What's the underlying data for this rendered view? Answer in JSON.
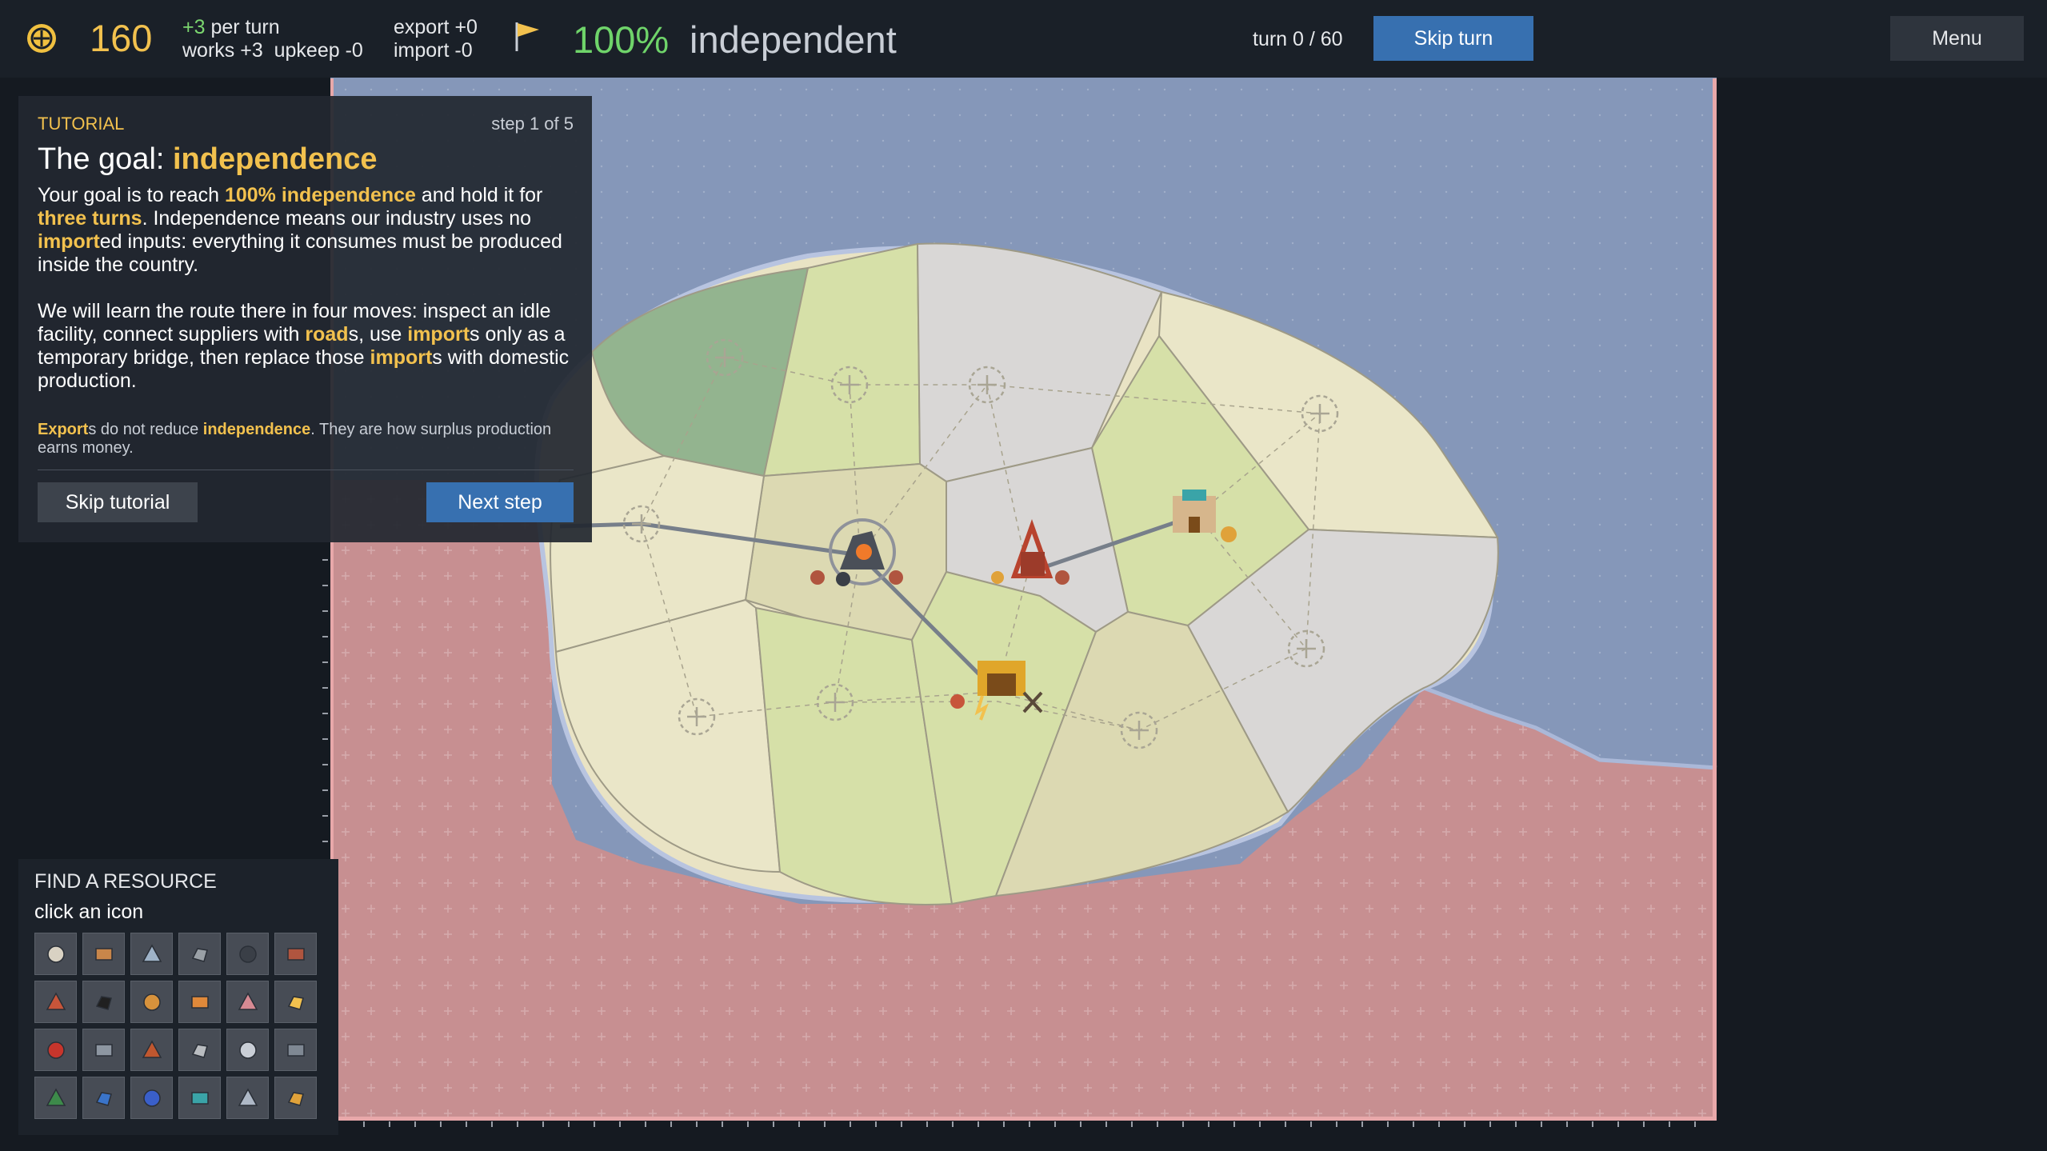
{
  "topbar": {
    "money": "160",
    "per_turn_value": "+3",
    "per_turn_label": "per turn",
    "works_line": "works +3  upkeep -0",
    "export_label": "export",
    "export_value": "+0",
    "import_line": "import -0",
    "independence_pct": "100%",
    "independence_label": "independent",
    "turn": "turn 0 / 60",
    "skip_turn": "Skip turn",
    "menu": "Menu"
  },
  "tutorial": {
    "label": "TUTORIAL",
    "step": "step 1 of 5",
    "title_prefix": "The goal: ",
    "title_highlight": "independence",
    "p1": [
      {
        "t": "Your goal is to reach ",
        "hl": false
      },
      {
        "t": "100% independence",
        "hl": true
      },
      {
        "t": " and hold it for ",
        "hl": false
      },
      {
        "t": "three turns",
        "hl": true
      },
      {
        "t": ". Independence means our industry uses no ",
        "hl": false
      },
      {
        "t": "import",
        "hl": true
      },
      {
        "t": "ed inputs: everything it consumes must be produced inside the country.",
        "hl": false
      }
    ],
    "p2": [
      {
        "t": "We will learn the route there in four moves: inspect an idle facility, connect suppliers with ",
        "hl": false
      },
      {
        "t": "road",
        "hl": true
      },
      {
        "t": "s, use ",
        "hl": false
      },
      {
        "t": "import",
        "hl": true
      },
      {
        "t": "s only as a temporary bridge, then replace those ",
        "hl": false
      },
      {
        "t": "import",
        "hl": true
      },
      {
        "t": "s with domestic production.",
        "hl": false
      }
    ],
    "p3": [
      {
        "t": "Export",
        "hl": true
      },
      {
        "t": "s do not reduce ",
        "hl": false
      },
      {
        "t": "independence",
        "hl": true
      },
      {
        "t": ". They are how surplus production earns money.",
        "hl": false
      }
    ],
    "skip_button": "Skip tutorial",
    "next_button": "Next step"
  },
  "finder": {
    "title": "FIND A RESOURCE",
    "subtitle": "click an icon",
    "icons": [
      "cotton-icon",
      "logs-icon",
      "steel-sheet-icon",
      "ore-icon",
      "coal-icon",
      "copper-ore-icon",
      "bricks-icon",
      "oil-icon",
      "crate-icon",
      "chemicals-icon",
      "rubber-icon",
      "electricity-icon",
      "canister-icon",
      "steel-bars-icon",
      "barrel-icon",
      "concrete-icon",
      "tools-icon",
      "engine-icon",
      "circuit-icon",
      "truck-icon",
      "machinery-icon",
      "robot-arm-icon",
      "aircraft-icon",
      "gears-icon"
    ],
    "icon_colors": [
      "#d9d2c3",
      "#c8864a",
      "#9fb3c8",
      "#9aa0a6",
      "#3a3f47",
      "#b0553f",
      "#c7553a",
      "#202020",
      "#d7923c",
      "#e0893a",
      "#d78a93",
      "#f2c14e",
      "#c7352c",
      "#8d96a1",
      "#c0572f",
      "#b9bcc0",
      "#c9ced6",
      "#7f8893",
      "#3d8a4a",
      "#3a74c9",
      "#3a5fc9",
      "#3aa4a8",
      "#aeb8c6",
      "#e0a23a"
    ]
  },
  "colors": {
    "accent": "#f2c14e",
    "positive": "#6fd46a",
    "button_blue": "#3770b0",
    "sea": "#8597b9",
    "foreign": "#c78f91"
  }
}
